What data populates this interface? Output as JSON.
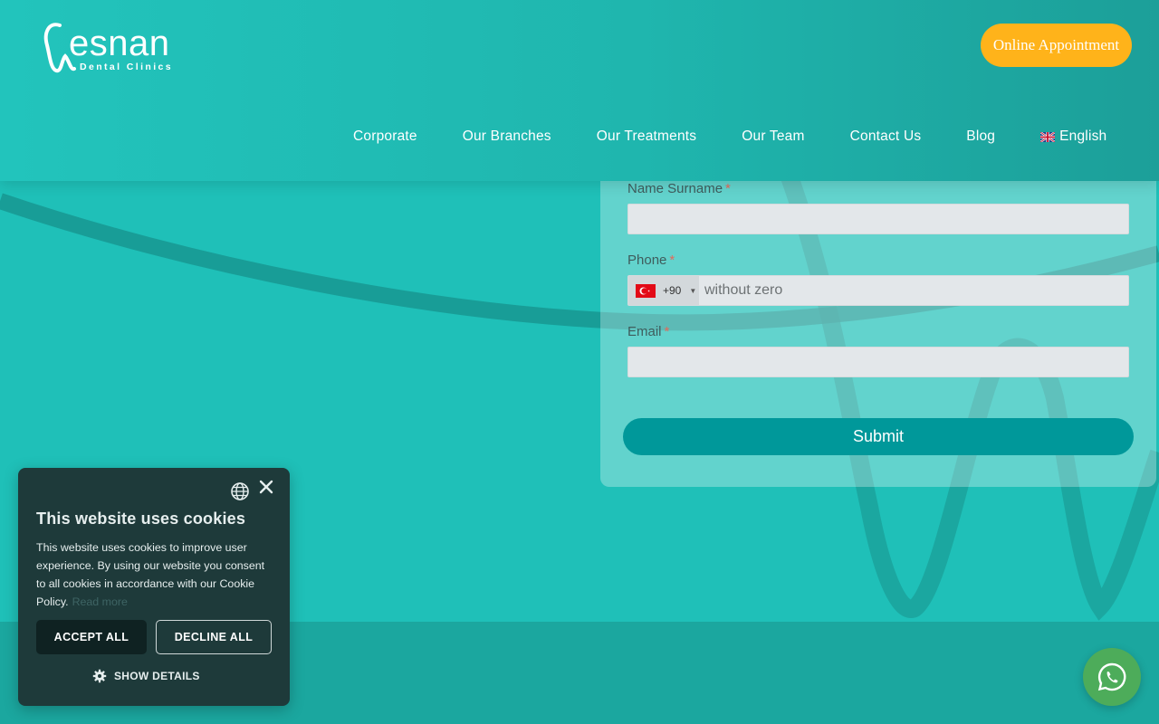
{
  "brand": {
    "logo_word": "esnan",
    "logo_sub": "Dental Clinics"
  },
  "header": {
    "cta_label": "Online Appointment",
    "nav": [
      {
        "label": "Corporate"
      },
      {
        "label": "Our Branches"
      },
      {
        "label": "Our Treatments"
      },
      {
        "label": "Our Team"
      },
      {
        "label": "Contact Us"
      },
      {
        "label": "Blog"
      },
      {
        "label": "English",
        "icon": "uk-flag-icon"
      }
    ]
  },
  "form": {
    "name_label": "Name Surname",
    "phone_label": "Phone",
    "email_label": "Email",
    "required_mark": "*",
    "phone_country_code": "+90",
    "phone_placeholder": "without zero",
    "submit_label": "Submit"
  },
  "cookie": {
    "title": "This website uses cookies",
    "body": "This website uses cookies to improve user experience. By using our website you consent to all cookies in accordance with our Cookie Policy.",
    "read_more": "Read more",
    "accept_label": "ACCEPT ALL",
    "decline_label": "DECLINE ALL",
    "show_details_label": "SHOW DETAILS"
  },
  "colors": {
    "background": "#1fc0b8",
    "cta": "#ffb31a",
    "submit": "#00989a",
    "cookie_bg": "#1e3a3a",
    "whatsapp": "#4dac5a"
  }
}
